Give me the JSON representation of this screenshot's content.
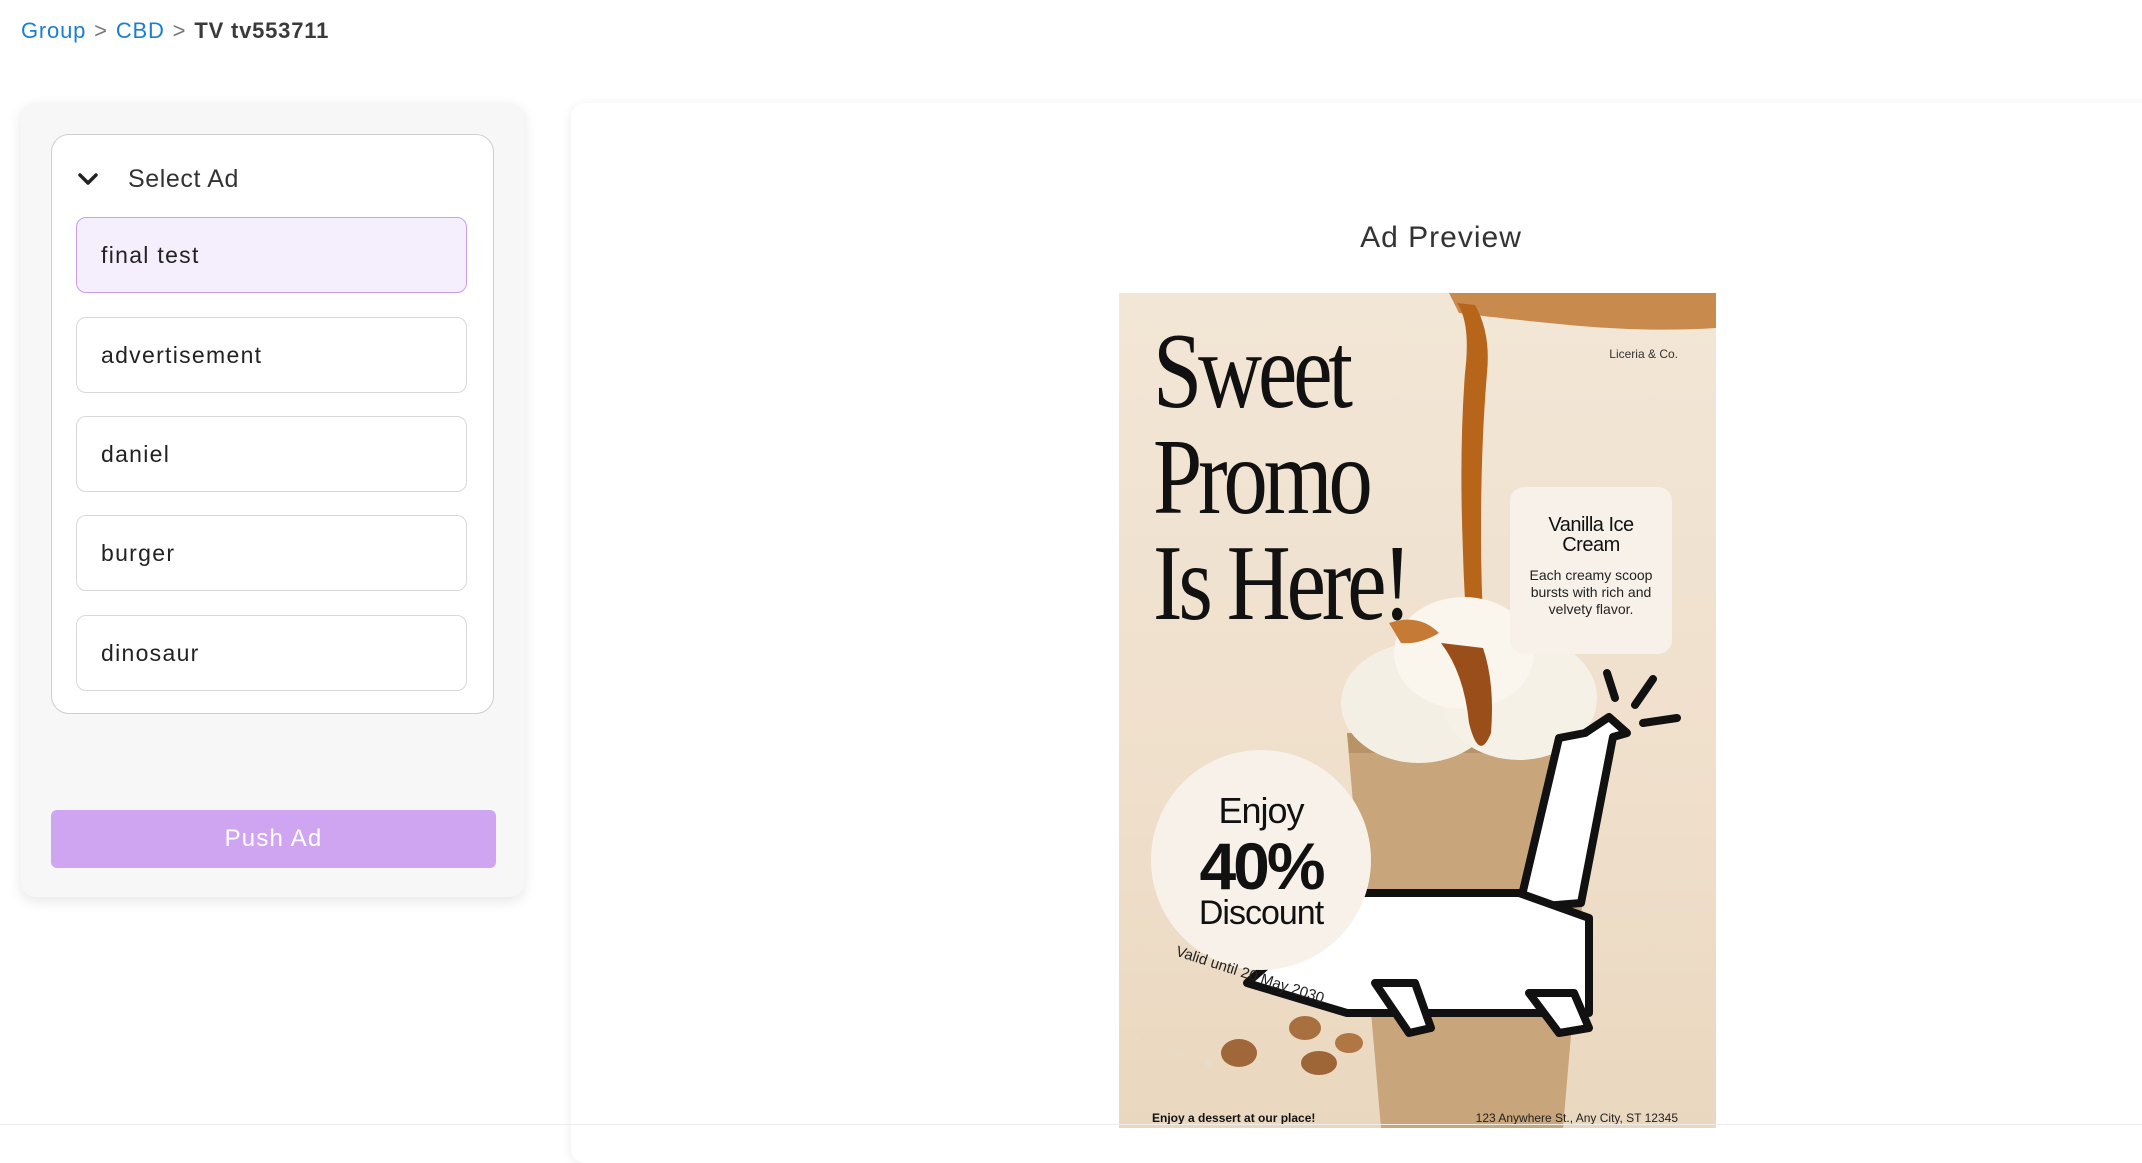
{
  "breadcrumb": {
    "items": [
      {
        "label": "Group"
      },
      {
        "label": "CBD"
      },
      {
        "label": "TV tv553711"
      }
    ],
    "separator": ">"
  },
  "sidebar": {
    "select_title": "Select Ad",
    "ads": [
      {
        "label": "final test",
        "selected": true
      },
      {
        "label": "advertisement",
        "selected": false
      },
      {
        "label": "daniel",
        "selected": false
      },
      {
        "label": "burger",
        "selected": false
      },
      {
        "label": "dinosaur",
        "selected": false
      }
    ],
    "push_label": "Push Ad"
  },
  "preview": {
    "title": "Ad Preview",
    "poster": {
      "headline_1": "Sweet",
      "headline_2": "Promo",
      "headline_3": "Is Here!",
      "brand": "Liceria & Co.",
      "product_name": "Vanilla Ice Cream",
      "product_desc": "Each creamy scoop bursts with rich and velvety flavor.",
      "discount_enjoy": "Enjoy",
      "discount_percent": "40%",
      "discount_label": "Discount",
      "valid_text": "Valid until 20 May 2030",
      "footer_left": "Enjoy a dessert at our place!",
      "footer_right": "123 Anywhere St., Any City, ST 12345"
    }
  },
  "colors": {
    "link": "#1a7fd4",
    "accent": "#cfa5f2",
    "selected_bg": "#f5eefd",
    "selected_border": "#c99ef0"
  }
}
